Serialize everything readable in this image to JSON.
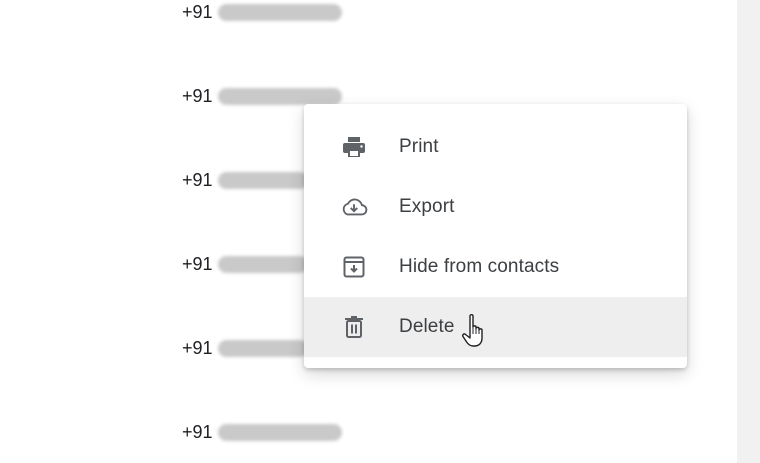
{
  "contacts": [
    {
      "phone_prefix": "+91"
    },
    {
      "phone_prefix": "+91"
    },
    {
      "phone_prefix": "+91"
    },
    {
      "phone_prefix": "+91"
    },
    {
      "phone_prefix": "+91"
    },
    {
      "phone_prefix": "+91"
    }
  ],
  "menu": {
    "items": [
      {
        "label": "Print",
        "icon": "printer-icon"
      },
      {
        "label": "Export",
        "icon": "cloud-download-icon"
      },
      {
        "label": "Hide from contacts",
        "icon": "archive-icon"
      },
      {
        "label": "Delete",
        "icon": "trash-icon",
        "state": "hovered"
      }
    ]
  },
  "colors": {
    "icon": "#5f6368",
    "label": "#3c4043",
    "hover_background": "#eeeeee",
    "scrollbar_track": "#f1f1f1"
  }
}
